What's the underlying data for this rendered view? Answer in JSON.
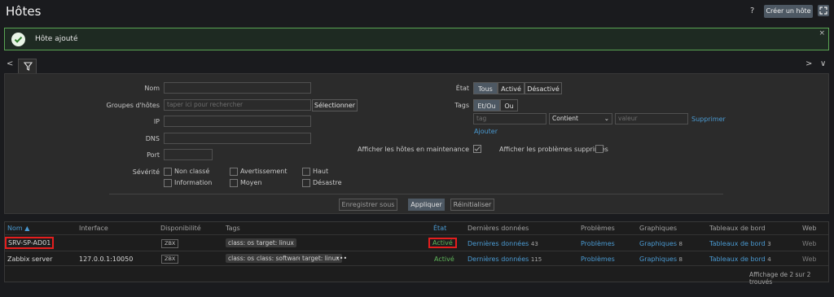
{
  "header": {
    "title": "Hôtes",
    "help_label": "?",
    "create_label": "Créer un hôte"
  },
  "message": {
    "text": "Hôte ajouté",
    "close": "×"
  },
  "nav": {
    "prev": "<",
    "next": ">",
    "expand": "∨"
  },
  "filter": {
    "name_label": "Nom",
    "name_value": "",
    "hostgroups_label": "Groupes d'hôtes",
    "hostgroups_placeholder": "taper ici pour rechercher",
    "select_label": "Sélectionner",
    "ip_label": "IP",
    "dns_label": "DNS",
    "port_label": "Port",
    "severity_label": "Sévérité",
    "severities": [
      "Non classé",
      "Avertissement",
      "Haut",
      "Information",
      "Moyen",
      "Désastre"
    ],
    "state_label": "État",
    "state_options": [
      "Tous",
      "Activé",
      "Désactivé"
    ],
    "state_selected": "Tous",
    "tags_label": "Tags",
    "tags_ops": [
      "Et/Ou",
      "Ou"
    ],
    "tag_placeholder": "tag",
    "tag_operator": "Contient",
    "value_placeholder": "valeur",
    "remove_label": "Supprimer",
    "add_label": "Ajouter",
    "maintenance_label": "Afficher les hôtes en maintenance",
    "suppressed_label": "Afficher les problèmes supprimés",
    "save_as_label": "Enregistrer sous",
    "apply_label": "Appliquer",
    "reset_label": "Réinitialiser"
  },
  "table": {
    "headers": {
      "name": "Nom ▲",
      "interface": "Interface",
      "availability": "Disponibilité",
      "tags": "Tags",
      "state": "État",
      "latest": "Dernières données",
      "problems": "Problèmes",
      "graphs": "Graphiques",
      "dashboards": "Tableaux de bord",
      "web": "Web"
    },
    "rows": [
      {
        "name": "SRV-SP-AD01",
        "interface": "",
        "availability": "ZBX",
        "tags": [
          "class: os",
          "target: linux"
        ],
        "state": "Activé",
        "latest": "Dernières données",
        "latest_count": "43",
        "problems": "Problèmes",
        "graphs": "Graphiques",
        "graphs_count": "8",
        "dashboards": "Tableaux de bord",
        "dashboards_count": "3",
        "web": "Web"
      },
      {
        "name": "Zabbix server",
        "interface": "127.0.0.1:10050",
        "availability": "ZBX",
        "tags": [
          "class: os",
          "class: software",
          "target: linux"
        ],
        "more": "•••",
        "state": "Activé",
        "latest": "Dernières données",
        "latest_count": "115",
        "problems": "Problèmes",
        "graphs": "Graphiques",
        "graphs_count": "8",
        "dashboards": "Tableaux de bord",
        "dashboards_count": "4",
        "web": "Web"
      }
    ],
    "footer": "Affichage de 2 sur 2 trouvés"
  },
  "colors": {
    "accent": "#4d5863",
    "link": "#4a9ad2",
    "success": "#59a553",
    "highlight": "#e41e1e"
  }
}
